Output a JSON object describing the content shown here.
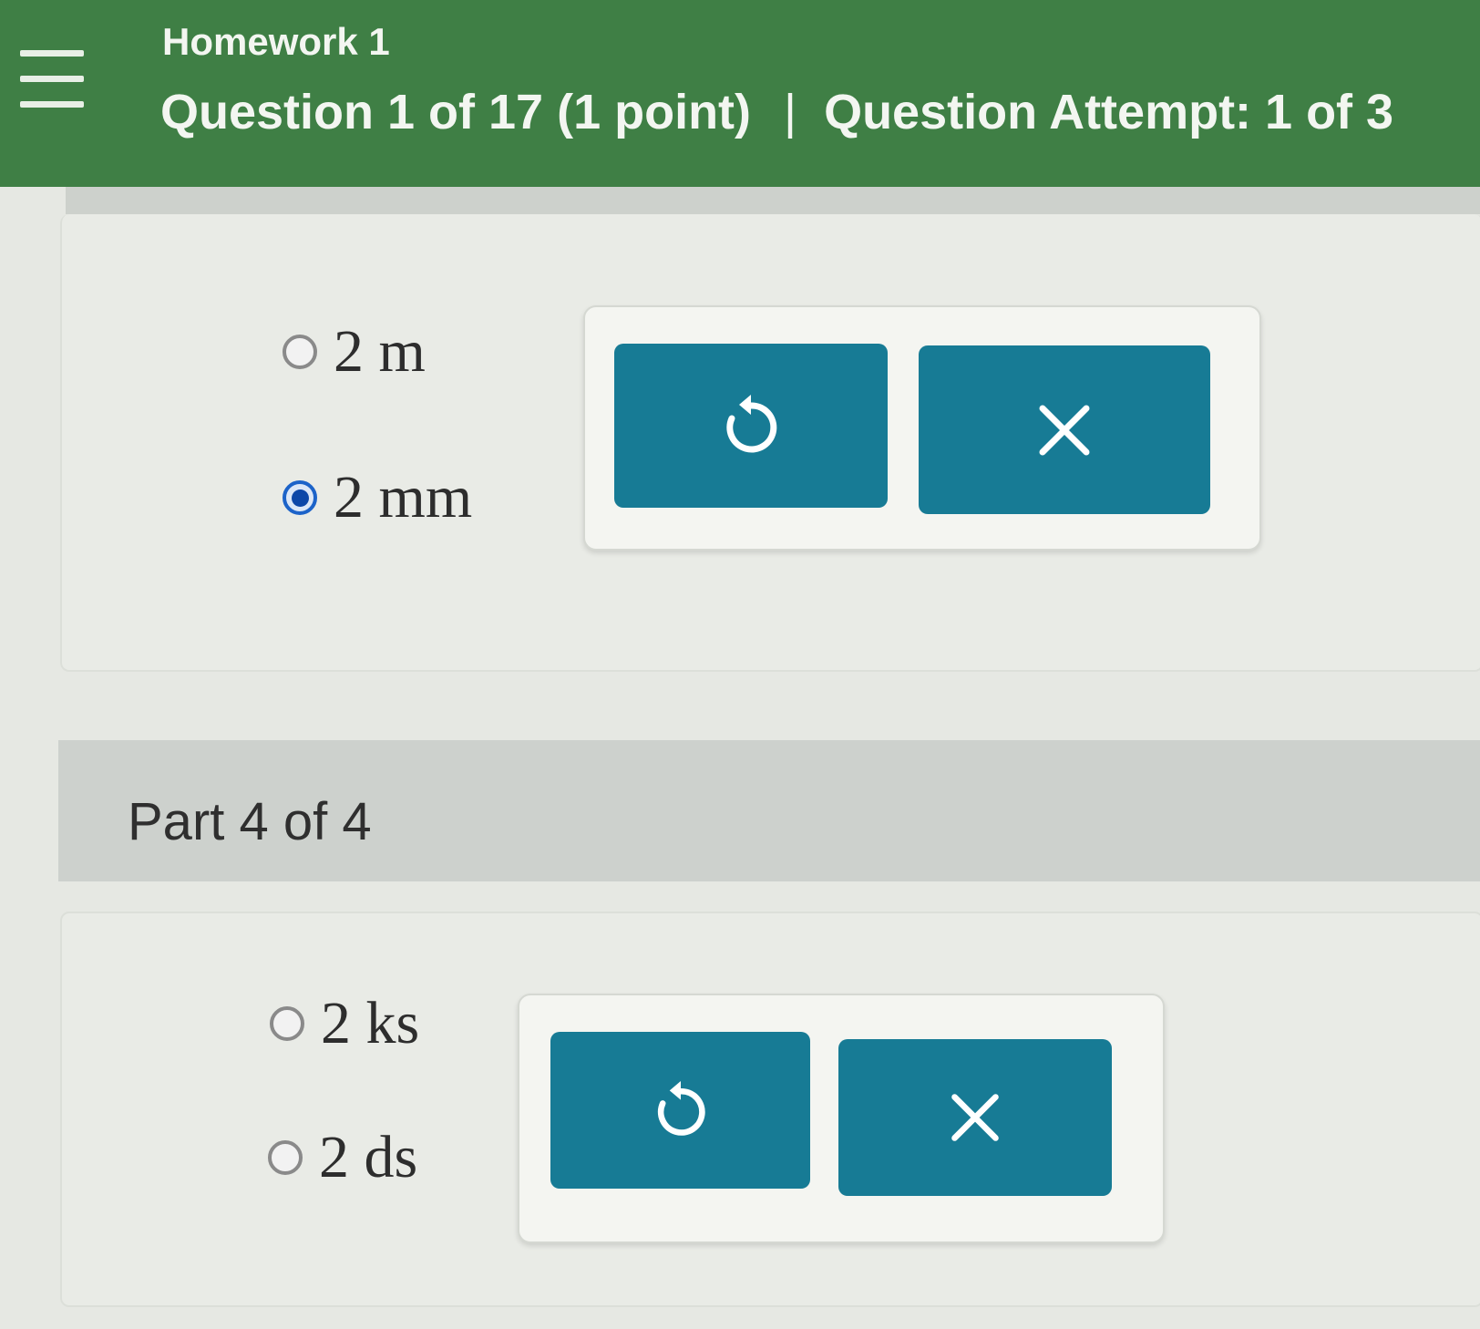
{
  "header": {
    "assignment_title": "Homework 1",
    "question_info": "Question 1 of 17 (1 point)",
    "separator": "|",
    "attempt_info": "Question Attempt: 1 of 3",
    "menu_icon": "hamburger-menu-icon"
  },
  "part3": {
    "options": [
      {
        "label": "2 m",
        "selected": false
      },
      {
        "label": "2 mm",
        "selected": true
      }
    ],
    "tools": {
      "undo_icon": "undo-icon",
      "clear_icon": "close-icon"
    }
  },
  "part4": {
    "label": "Part 4 of 4",
    "options": [
      {
        "label": "2 ks",
        "selected": false
      },
      {
        "label": "2 ds",
        "selected": false
      }
    ],
    "tools": {
      "undo_icon": "undo-icon",
      "clear_icon": "close-icon"
    }
  },
  "colors": {
    "header_bg": "#3f7f45",
    "button_bg": "#177b95",
    "radio_selected": "#0d47a8",
    "part_bar_bg": "#cdd1cd"
  }
}
